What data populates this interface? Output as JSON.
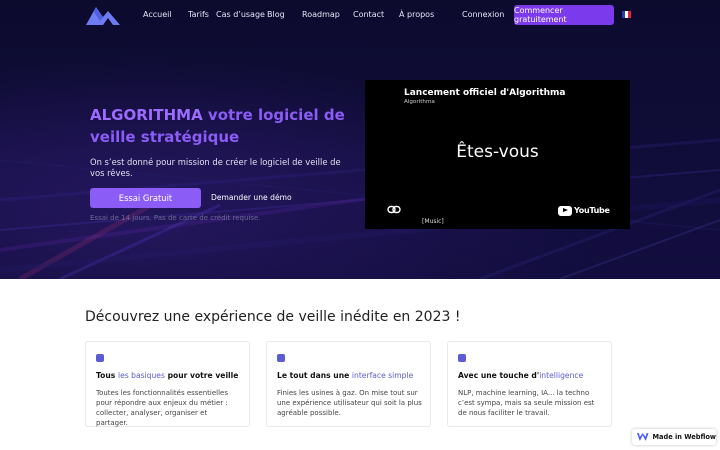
{
  "nav": {
    "links": [
      "Accueil",
      "Tarifs",
      "Cas d’usage",
      "Blog",
      "Roadmap",
      "Contact",
      "À propos",
      "Connexion"
    ],
    "cta": "Commencer gratuitement",
    "language_flag": "fr-flag-icon"
  },
  "hero": {
    "title_accent": "ALGORITHMA",
    "title_rest": "votre logiciel de veille stratégique",
    "subtitle": "On s’est donné pour mission de créer le logiciel de veille de vos rêves.",
    "primary_button": "Essai Gratuit",
    "secondary_button": "Demander une démo",
    "note": "Essai de 14 jours. Pas de carte de crédit requise."
  },
  "video": {
    "title": "Lancement officiel d'Algorithma",
    "channel": "Algorithma",
    "main_text": "Êtes-vous",
    "caption": "[Music]",
    "brand": "YouTube"
  },
  "features": {
    "title": "Découvrez une expérience de veille inédite en 2023 !",
    "cards": [
      {
        "title_pre": "Tous ",
        "title_hl": "les basiques",
        "title_post": " pour votre veille",
        "body": "Toutes les fonctionnalités essentielles pour répondre aux enjeux du métier : collecter, analyser, organiser et partager."
      },
      {
        "title_pre": "Le tout dans une ",
        "title_hl": "interface simple",
        "title_post": "",
        "body": "Finies les usines à gaz. On mise tout sur une expérience utilisateur qui soit la plus agréable possible."
      },
      {
        "title_pre": "Avec une touche d'",
        "title_hl": "intelligence",
        "title_post": "",
        "body": "NLP, machine learning, IA... la techno c’est sympa, mais sa seule mission est de nous faciliter le travail."
      }
    ]
  },
  "badge": {
    "label": "Made in Webflow"
  },
  "colors": {
    "accent": "#8b5cf6",
    "hero_bg": "#0f0c36",
    "highlight": "#5b5bd6"
  }
}
